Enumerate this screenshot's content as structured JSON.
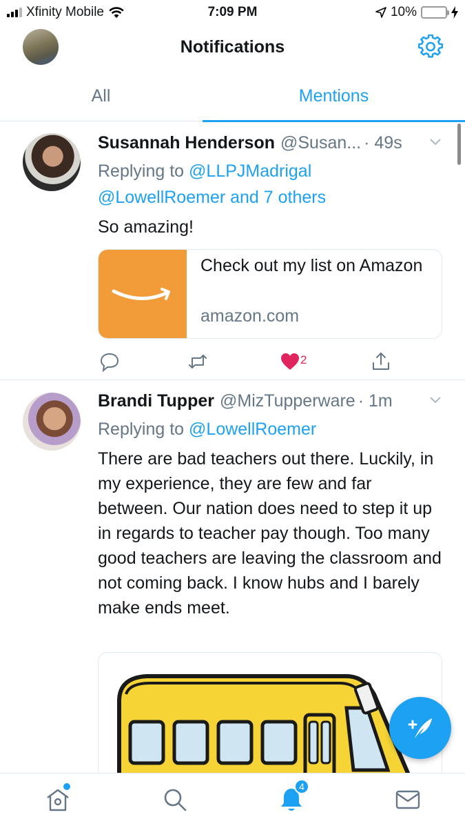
{
  "status_bar": {
    "carrier": "Xfinity Mobile",
    "time": "7:09 PM",
    "battery": "10%",
    "battery_level": 0.1
  },
  "header": {
    "title": "Notifications"
  },
  "tabs": [
    {
      "label": "All",
      "active": false
    },
    {
      "label": "Mentions",
      "active": true
    }
  ],
  "tweets": [
    {
      "author": "Susannah Henderson",
      "handle": "@Susan...",
      "time": "· 49s",
      "replying_prefix": "Replying to ",
      "replying_line1": "@LLPJMadrigal",
      "replying_line2": "@LowellRoemer and 7 others",
      "text": "So amazing!",
      "card": {
        "title": "Check out my list on Amazon",
        "domain": "amazon.com"
      },
      "like_count": "2"
    },
    {
      "author": "Brandi Tupper",
      "handle": "@MizTupperware",
      "time": "· 1m",
      "replying_prefix": "Replying to ",
      "replying_line1": "@LowellRoemer",
      "text": "There are bad teachers out there. Luckily, in my experience, they are few and far between. Our nation does need to step it up in regards to teacher pay though. Too many good teachers are leaving the classroom and not coming back. I know hubs and I barely make ends meet."
    }
  ],
  "bottom_nav": {
    "notification_badge": "4"
  },
  "colors": {
    "accent": "#1da1f2",
    "like": "#e0245e",
    "amazon_orange": "#f19c38",
    "secondary_text": "#657786"
  }
}
